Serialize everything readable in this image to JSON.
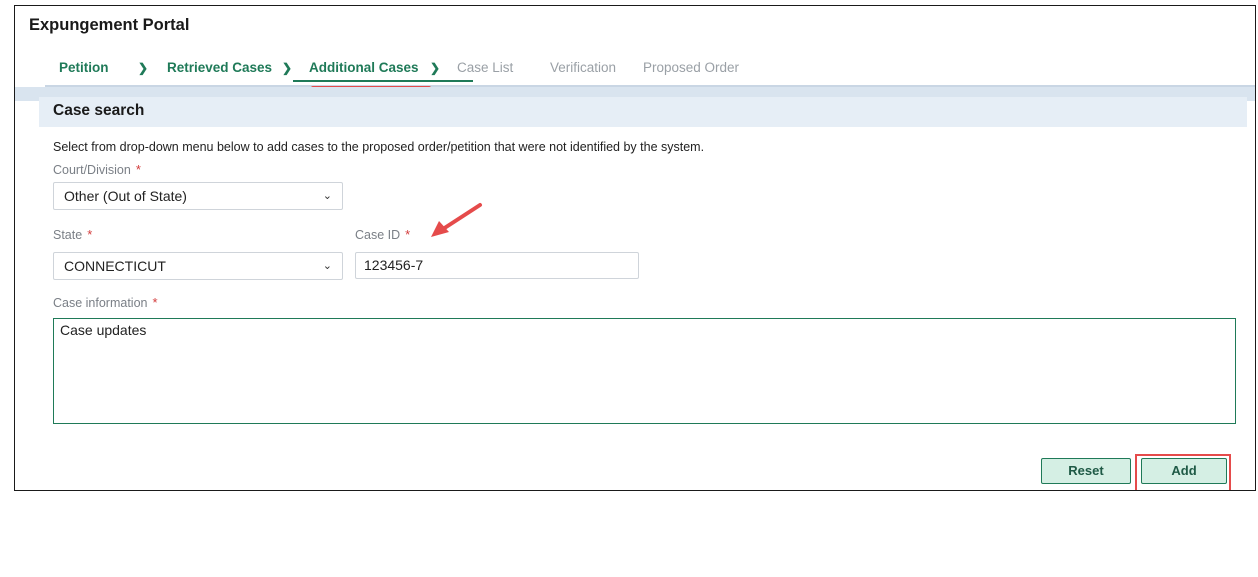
{
  "app": {
    "title": "Expungement Portal"
  },
  "steps": [
    {
      "label": "Petition",
      "state": "done"
    },
    {
      "label": "Retrieved Cases",
      "state": "done"
    },
    {
      "label": "Additional Cases",
      "state": "active"
    },
    {
      "label": "Case List",
      "state": "future"
    },
    {
      "label": "Verification",
      "state": "future"
    },
    {
      "label": "Proposed Order",
      "state": "future"
    }
  ],
  "panel": {
    "title": "Case search",
    "instructions": "Select from drop-down menu below to add cases to the proposed order/petition that were not identified by the system."
  },
  "form": {
    "court_label": "Court/Division",
    "court_value": "Other (Out of State)",
    "state_label": "State",
    "state_value": "CONNECTICUT",
    "case_id_label": "Case ID",
    "case_id_value": "123456-7",
    "case_info_label": "Case information",
    "case_info_value": "Case updates",
    "required_mark": "*"
  },
  "buttons": {
    "reset": "Reset",
    "add": "Add"
  },
  "colors": {
    "accent": "#1f7a58",
    "required": "#d33b3b",
    "annotation": "#e54b4b",
    "header_band": "#e6eef6"
  },
  "icons": {
    "step_separator": "chevron-right-icon",
    "dropdown": "chevron-down-icon",
    "annotation": "red-arrow-icon"
  }
}
